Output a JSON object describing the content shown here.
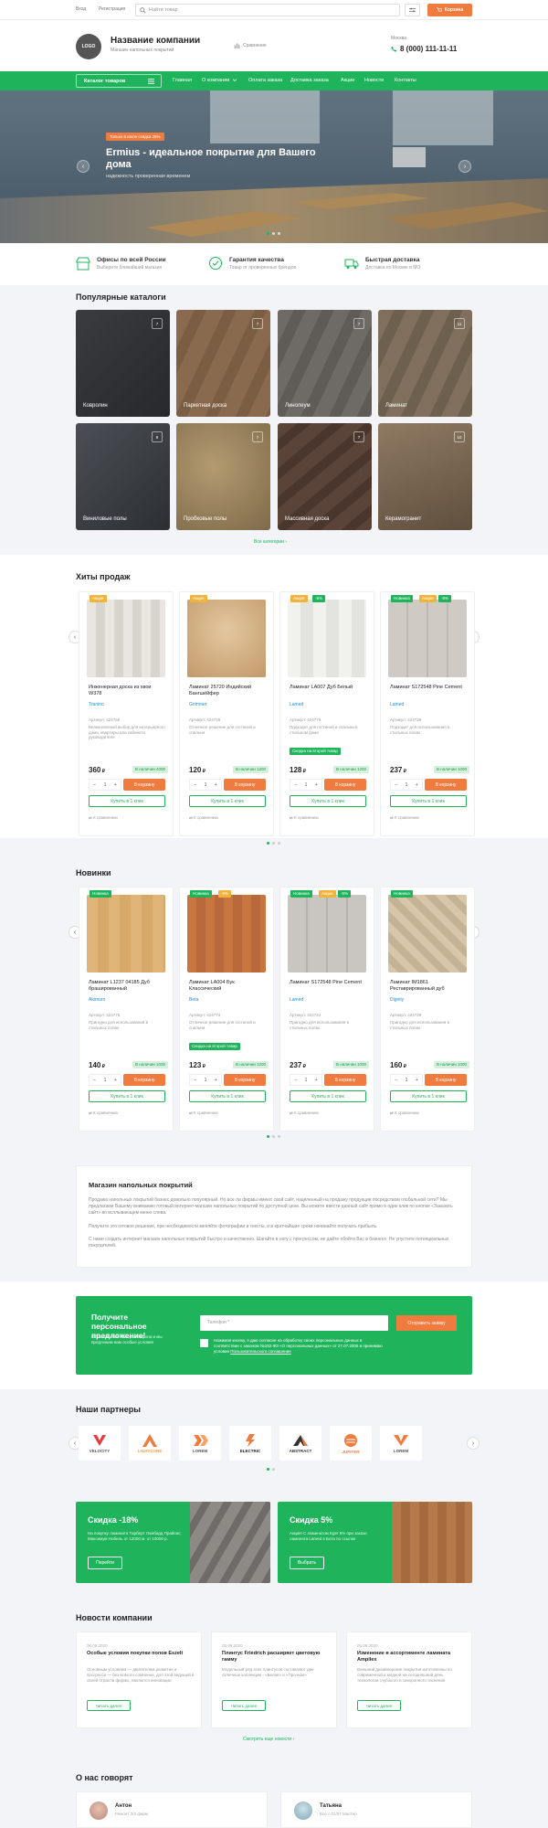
{
  "topbar": {
    "login": "Вход",
    "register": "Регистрация",
    "search_placeholder": "Найти товар",
    "cart": "Корзина"
  },
  "header": {
    "logo": "LOGO",
    "company": "Название компании",
    "tagline": "Магазин напольных покрытий",
    "compare": "Сравнение",
    "city": "Москва",
    "phone": "8 (000) 111-11-11"
  },
  "nav": {
    "catalog": "Каталог товаров",
    "items": [
      "Главная",
      "О компании",
      "Оплата заказа",
      "Доставка заказа",
      "Акции",
      "Новости",
      "Контакты"
    ]
  },
  "hero": {
    "badge": "Только в июле скидка 25%",
    "title": "Ermius - идеальное покрытие для Вашего дома",
    "subtitle": "надежность проверенная временем"
  },
  "features": [
    {
      "title": "Офисы по всей России",
      "sub": "Выберите ближайший магазин"
    },
    {
      "title": "Гарантия качества",
      "sub": "Товар от проверенных брендов"
    },
    {
      "title": "Быстрая доставка",
      "sub": "Доставка по Москве в МО"
    }
  ],
  "catalogs": {
    "title": "Популярные каталоги",
    "all": "Все категории",
    "items": [
      {
        "label": "Ковролин",
        "count": "7"
      },
      {
        "label": "Паркетная доска",
        "count": "7"
      },
      {
        "label": "Линолеум",
        "count": "7"
      },
      {
        "label": "Ламинат",
        "count": "11"
      },
      {
        "label": "Виниловые полы",
        "count": "9"
      },
      {
        "label": "Пробковые полы",
        "count": "7"
      },
      {
        "label": "Массивная доска",
        "count": "7"
      },
      {
        "label": "Керамогранит",
        "count": "10"
      }
    ]
  },
  "hits": {
    "title": "Хиты продаж",
    "products": [
      {
        "badges": [
          "Акция"
        ],
        "name": "Инженерная доска из хвои W378",
        "brand": "Tranino",
        "art": "Артикул: 424766",
        "desc": "Великолепный выбор для интерьерного дома, квартиры или кабинета руководителя",
        "tag": "",
        "old": "",
        "price": "360",
        "stock": "В наличии 4000",
        "cart": "В корзину",
        "oneclick": "Купить в 1 клик",
        "compare": "К сравнению"
      },
      {
        "badges": [
          "Акция"
        ],
        "name": "Ламинат 25720 Индийский Бангшёйфер",
        "brand": "Grimmer",
        "art": "Артикул: 424728",
        "desc": "Отличное решение для гостиной и спальни",
        "tag": "",
        "old": "",
        "price": "120",
        "stock": "В наличии 1200",
        "cart": "В корзину",
        "oneclick": "Купить в 1 клик",
        "compare": "К сравнению"
      },
      {
        "badges": [
          "Акция",
          "-5%"
        ],
        "name": "Ламинат LA007 Дуб Белый",
        "brand": "Lamed",
        "art": "Артикул: 424776",
        "desc": "Подходит для гостиной и спальни в стильном доме",
        "tag": "Скидка на второй товар",
        "old": "",
        "price": "128",
        "stock": "В наличии 1200",
        "cart": "В корзину",
        "oneclick": "Купить в 1 клик",
        "compare": "К сравнению"
      },
      {
        "badges": [
          "Новинка",
          "Акция",
          "-5%"
        ],
        "name": "Ламинат S172548 Pine Cement",
        "brand": "Lamed",
        "art": "Артикул: 424729",
        "desc": "Подходит для использования в стильных полах",
        "tag": "",
        "old": "",
        "price": "237",
        "stock": "В наличии 1000",
        "cart": "В корзину",
        "oneclick": "Купить в 1 клик",
        "compare": "К сравнению"
      }
    ]
  },
  "news_products": {
    "title": "Новинки",
    "products": [
      {
        "badges": [
          "Новинка"
        ],
        "name": "Ламинат L1237 04185 Дуб брашированный",
        "brand": "Akimuro",
        "art": "Артикул: 424776",
        "desc": "Пригодно для использования в стильных полах",
        "tag": "",
        "old": "",
        "price": "140",
        "stock": "В наличии 1000",
        "cart": "В корзину",
        "oneclick": "Купить в 1 клик",
        "compare": "К сравнению"
      },
      {
        "badges": [
          "Новинка",
          "-5%"
        ],
        "name": "Ламинат LA004 Бук Классический",
        "brand": "Beta",
        "art": "Артикул: 424774",
        "desc": "Отличное решение для гостиной и спальни",
        "tag": "Скидка на второй товар",
        "old": "",
        "price": "123",
        "stock": "В наличии 1200",
        "cart": "В корзину",
        "oneclick": "Купить в 1 клик",
        "compare": "К сравнению"
      },
      {
        "badges": [
          "Новинка",
          "Акция",
          "-5%"
        ],
        "name": "Ламинат S172548 Pine Cement",
        "brand": "Lamed",
        "art": "Артикул: 424724",
        "desc": "Пригодно для использования в стильных полах",
        "tag": "",
        "old": "",
        "price": "237",
        "stock": "В наличии 1000",
        "cart": "В корзину",
        "oneclick": "Купить в 1 клик",
        "compare": "К сравнению"
      },
      {
        "badges": [
          "Новинка"
        ],
        "name": "Ламинат IM1861 Реставрированный дуб",
        "brand": "Dignity",
        "art": "Артикул: 424736",
        "desc": "Пригодно для использования в стильных полах",
        "tag": "",
        "old": "",
        "price": "160",
        "stock": "В наличии 1000",
        "cart": "В корзину",
        "oneclick": "Купить в 1 клик",
        "compare": "К сравнению"
      }
    ]
  },
  "about": {
    "title": "Магазин напольных покрытий",
    "p1": "Продажа напольных покрытий бизнес довольно популярный. Но все ли фирмы имеют свой сайт, нацеленный на продажу продукции посредством глобальной сети? Мы предлагаем Вашему вниманию готовый интернет-магазин напольных покрытий по доступной цене. Вы можете ввести данный сайт прямо в один клик по кнопке «Заказать сайт» во всплывающем меню слева.",
    "p2": "Получите это готовое решение, при необходимости меняйте фотографии и тексты, и в кратчайшие сроки начинайте получать прибыль.",
    "p3": "С нами создать интернет магазин напольных покрытий быстро и качественно. Шагайте в ногу с прогрессом, не дайте обойти Вас в бизнесе. Не упустите потенциальных покупателей."
  },
  "subscribe": {
    "title": "Получите персональное предложение!",
    "text": "Оставьте свой номер телефона и мы предложим вам особые условия",
    "placeholder": "Телефон *",
    "button": "Отправить заявку",
    "consent": "Нажимая кнопку, я даю согласие на обработку своих персональных данных в соответствии с законом №152-ФЗ «О персональных данных» от 27.07.2006 и принимаю условия",
    "policy": "Пользовательского соглашения"
  },
  "partners": {
    "title": "Наши партнеры",
    "items": [
      "VELOCITY",
      "LIGHTCORE",
      "LOREM",
      "ELECTRIC",
      "ABSTRACT",
      "JUPITER",
      "LOREM"
    ]
  },
  "promos": [
    {
      "title": "Скидка -18%",
      "text": "На покупку ламината Тарберт Ломбард Прайсис, Максимум Нобель от 12000 м. от 10000 р.",
      "button": "Перейти"
    },
    {
      "title": "Скидка 5%",
      "text": "Акция! С ламинатом Eger 5% при заказе ламината Lamed в Бота по ссылке",
      "button": "Выбрать"
    }
  ],
  "company_news": {
    "title": "Новости компании",
    "more": "Смотреть еще новости",
    "items": [
      {
        "date": "06.09.2020",
        "title": "Особые условия покупки полов Eszelt",
        "text": "Основным условием — двигателем развития и прогресса — без всякого сомнения, для этой ведущей в своей отрасли фирмы, являются инновации",
        "btn": "Читать далее"
      },
      {
        "date": "05.09.2020",
        "title": "Плинтус Friedrich расширяет цветовую гамму",
        "text": "Модельный ряд этих плинтусов составляют две отличные коллекции - «Белая» и «Прочная»",
        "btn": "Читать далее"
      },
      {
        "date": "05.09.2020",
        "title": "Изменение в ассортименте ламината Ampilex",
        "text": "Внешний дизайнерские покрытия изготовлены по современной и модной на сегодняшний день технологии глубокого и синхронного тиснения",
        "btn": "Читать далее"
      }
    ]
  },
  "reviews": {
    "title": "О нас говорят",
    "items": [
      {
        "name": "Антон",
        "role": "Ремонт 2/3 фирм"
      },
      {
        "name": "Татьяна",
        "role": "Все с 01/07 Мастер"
      }
    ]
  },
  "colors": {
    "green": "#1fb45c",
    "orange": "#f07b3f",
    "blue": "#1a8de0"
  }
}
